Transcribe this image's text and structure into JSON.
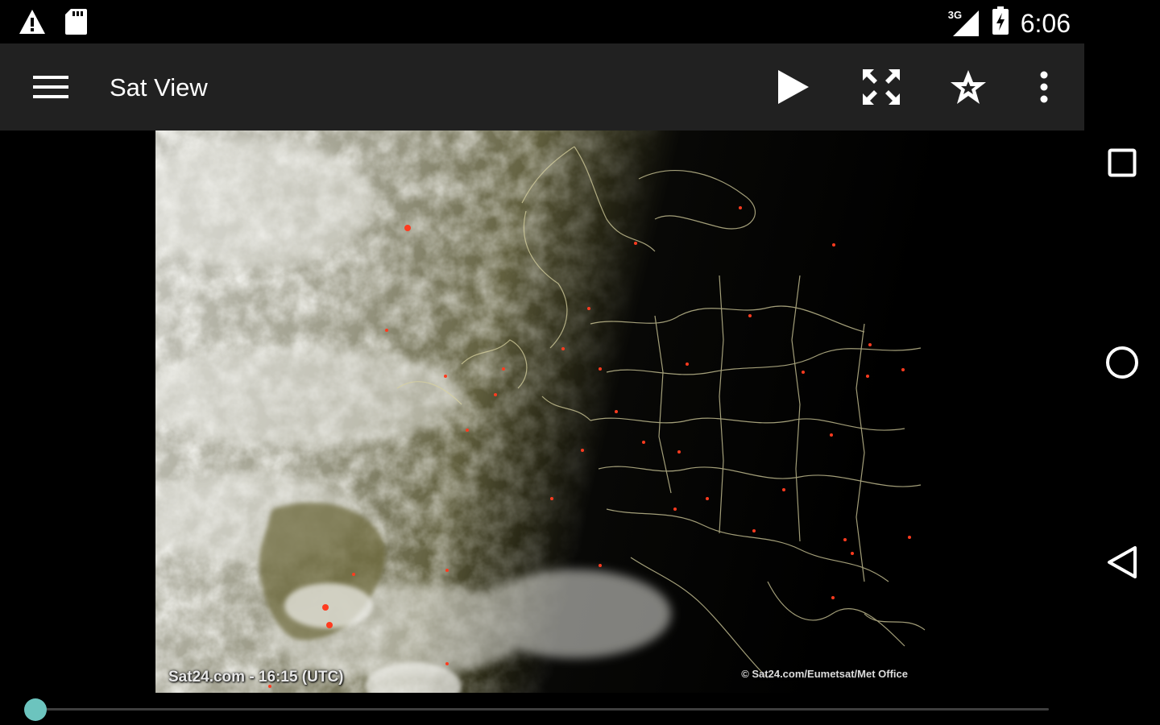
{
  "status_bar": {
    "time": "6:06",
    "network_label": "3G",
    "icons": [
      "warning-icon",
      "sd-card-icon",
      "signal-icon",
      "battery-charging-icon"
    ]
  },
  "toolbar": {
    "title": "Sat View",
    "menu_icon": "hamburger-menu-icon",
    "actions": [
      {
        "name": "play",
        "icon": "play-icon"
      },
      {
        "name": "fullscreen",
        "icon": "fullscreen-icon"
      },
      {
        "name": "favorite",
        "icon": "star-icon"
      },
      {
        "name": "more",
        "icon": "more-vert-icon"
      }
    ]
  },
  "map": {
    "caption": "Sat24.com - 16:15 (UTC)",
    "credit": "© Sat24.com/Eumetsat/Met Office"
  },
  "seekbar": {
    "progress": 0,
    "accent_color": "#6cc4be"
  },
  "navigation_bar": {
    "buttons": [
      "recents-icon",
      "home-icon",
      "back-icon"
    ]
  },
  "colors": {
    "toolbar_bg": "#212121",
    "background": "#000000",
    "accent": "#6cc4be",
    "lightning_dot": "#ff3b1f"
  }
}
